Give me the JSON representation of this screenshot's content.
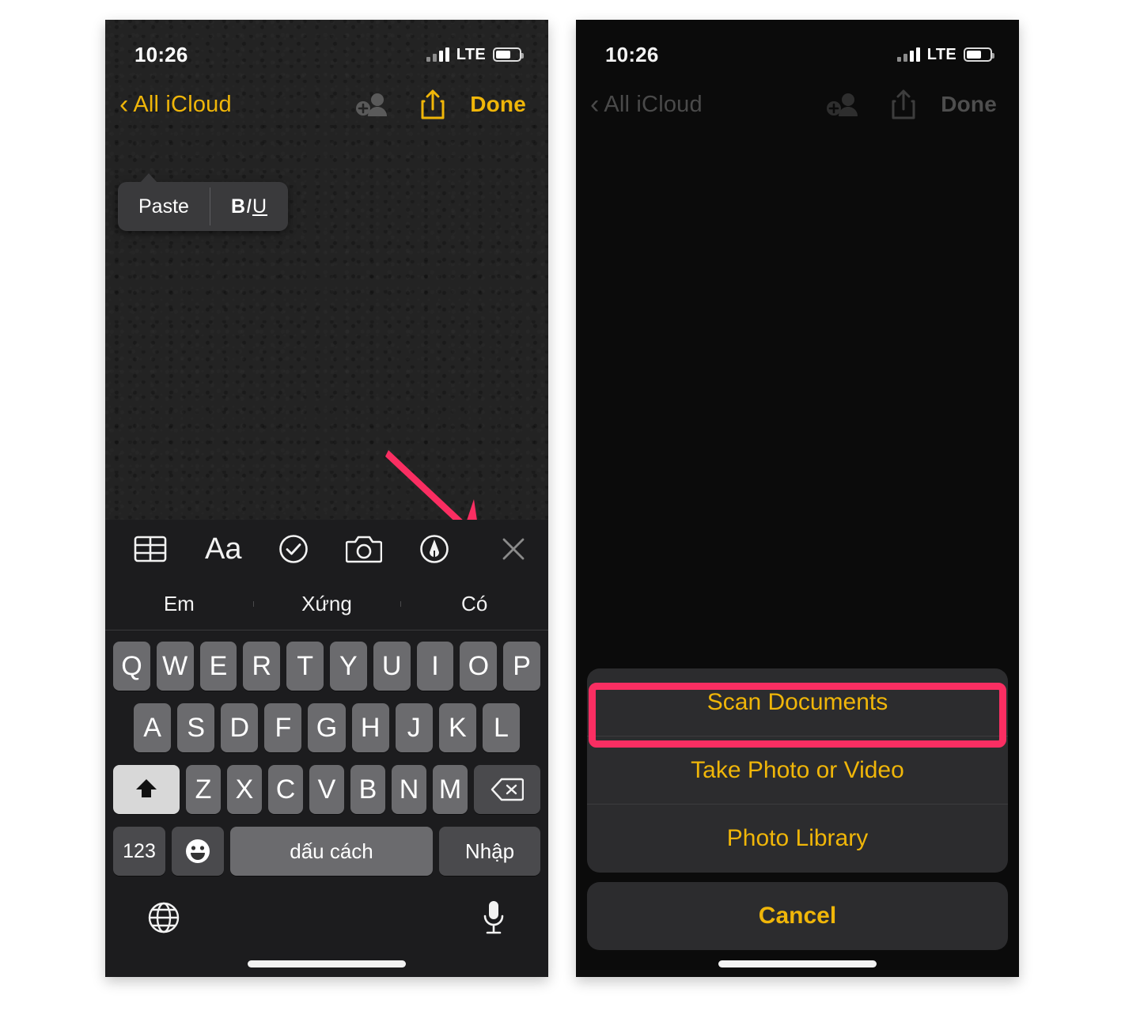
{
  "status_bar": {
    "time": "10:26",
    "network": "LTE",
    "battery_percent": 55
  },
  "nav": {
    "back_label": "All iCloud",
    "done_label": "Done",
    "icons": [
      "add-person-icon",
      "share-icon"
    ]
  },
  "left_panel": {
    "paste_popup": {
      "paste_label": "Paste",
      "format_label_b": "B",
      "format_label_i": "I",
      "format_label_u": "U"
    },
    "toolbar_icons": [
      "table-icon",
      "text-format-icon",
      "checklist-icon",
      "camera-icon",
      "markup-pen-icon",
      "close-icon"
    ],
    "toolbar_aa_label": "Aa",
    "suggestions": [
      "Em",
      "Xứng",
      "Có"
    ],
    "keyboard": {
      "row1": [
        "Q",
        "W",
        "E",
        "R",
        "T",
        "Y",
        "U",
        "I",
        "O",
        "P"
      ],
      "row2": [
        "A",
        "S",
        "D",
        "F",
        "G",
        "H",
        "J",
        "K",
        "L"
      ],
      "row3": [
        "Z",
        "X",
        "C",
        "V",
        "B",
        "N",
        "M"
      ],
      "shift_icon": "shift-icon",
      "backspace_icon": "backspace-icon",
      "numbers_label": "123",
      "emoji_icon": "emoji-icon",
      "space_label": "dấu cách",
      "enter_label": "Nhập",
      "globe_icon": "globe-icon",
      "mic_icon": "microphone-icon"
    },
    "annotation": {
      "arrow": "pink-arrow-pointing-to-camera-icon",
      "color": "#fa2e62"
    }
  },
  "right_panel": {
    "action_sheet": {
      "options": [
        "Scan Documents",
        "Take Photo or Video",
        "Photo Library"
      ],
      "cancel_label": "Cancel",
      "highlighted_option": "Scan Documents"
    },
    "highlight_color": "#fa2e62"
  },
  "colors": {
    "accent_yellow": "#f0b609",
    "highlight_pink": "#fa2e62",
    "sheet_bg": "#2c2c2e"
  }
}
